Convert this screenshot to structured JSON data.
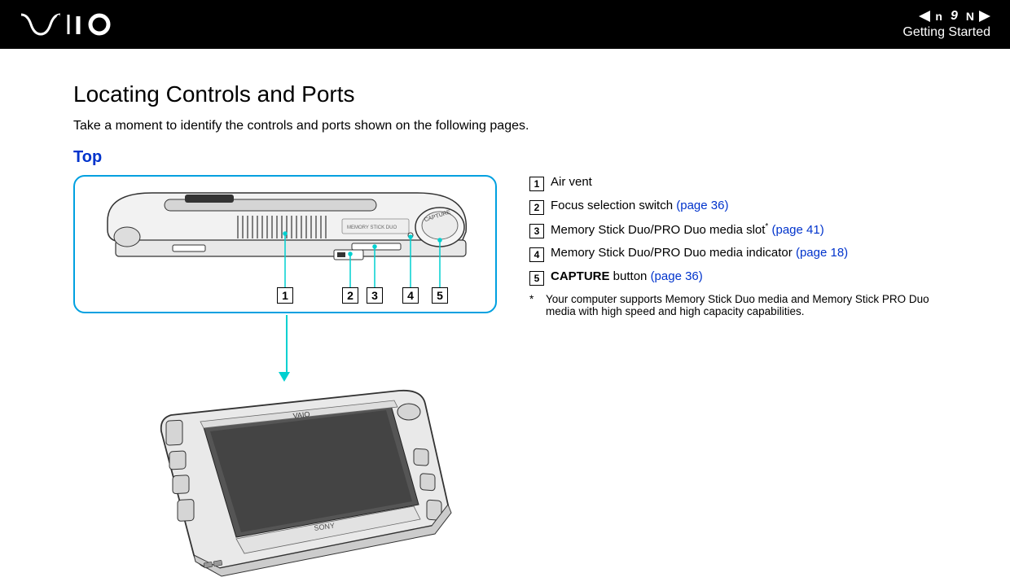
{
  "header": {
    "page_num": "9",
    "nav_left_letter": "n",
    "nav_right_letter": "N",
    "section": "Getting Started"
  },
  "title": "Locating Controls and Ports",
  "intro": "Take a moment to identify the controls and ports shown on the following pages.",
  "subsection": "Top",
  "callouts": [
    "1",
    "2",
    "3",
    "4",
    "5"
  ],
  "items": [
    {
      "num": "1",
      "text": "Air vent",
      "ref": ""
    },
    {
      "num": "2",
      "text": "Focus selection switch",
      "ref": "(page 36)"
    },
    {
      "num": "3",
      "text": "Memory Stick Duo/PRO Duo media slot",
      "sup": "*",
      "ref": "(page 41)"
    },
    {
      "num": "4",
      "text": "Memory Stick Duo/PRO Duo media indicator",
      "ref": "(page 18)"
    },
    {
      "num": "5",
      "text_bold": "CAPTURE",
      "text_rest": " button",
      "ref": "(page 36)"
    }
  ],
  "footnote": {
    "star": "*",
    "text": "Your computer supports Memory Stick Duo media and Memory Stick PRO Duo media with high speed and high capacity capabilities."
  }
}
